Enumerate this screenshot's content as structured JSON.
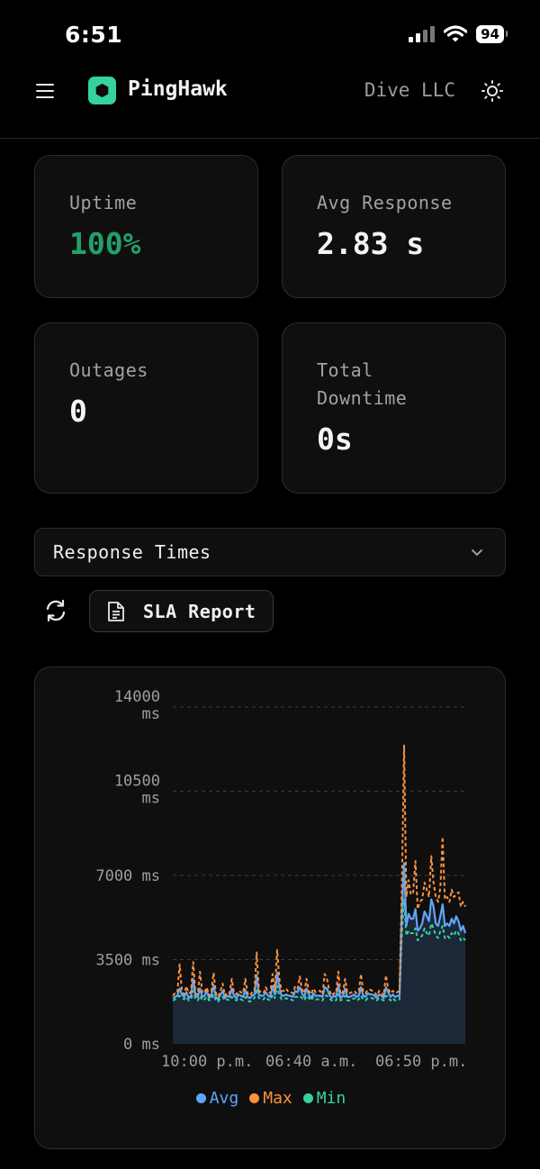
{
  "status": {
    "time": "6:51",
    "battery": "94"
  },
  "header": {
    "brand": "PingHawk",
    "org": "Dive LLC",
    "icons": [
      "menu-icon",
      "hexagon-logo-icon",
      "sun-icon"
    ]
  },
  "stats": [
    {
      "label": "Uptime",
      "value": "100%",
      "color": "#22a06b"
    },
    {
      "label": "Avg Response",
      "value": "2.83 s",
      "color": "#f4f4f5"
    },
    {
      "label": "Outages",
      "value": "0",
      "color": "#f4f4f5"
    },
    {
      "label": "Total\nDowntime",
      "value": "0s",
      "color": "#f4f4f5"
    }
  ],
  "controls": {
    "selected_view": "Response Times",
    "sla_button": "SLA Report"
  },
  "chart_data": {
    "type": "line",
    "title": "",
    "x_ticks": [
      "10:00 p.m.",
      "06:40 a.m.",
      "06:50 p.m."
    ],
    "y_ticks": [
      "0 ms",
      "3500 ms",
      "7000 ms",
      "10500 ms",
      "14000 ms"
    ],
    "ylim": [
      0,
      14000
    ],
    "grid": true,
    "legend_position": "bottom",
    "series": [
      {
        "name": "Avg",
        "color": "#60a5fa",
        "values": [
          1900,
          1950,
          2000,
          2300,
          2050,
          1950,
          2150,
          1900,
          2000,
          2700,
          2000,
          1950,
          2300,
          1950,
          2000,
          2200,
          1900,
          2000,
          2450,
          1950,
          1850,
          2050,
          2200,
          1900,
          2000,
          1950,
          2300,
          2000,
          1900,
          2050,
          2000,
          1950,
          2250,
          1950,
          1900,
          2000,
          2050,
          2850,
          2050,
          2000,
          2000,
          2150,
          2000,
          1950,
          2400,
          2050,
          2950,
          2350,
          2000,
          2000,
          2050,
          2000,
          2000,
          1950,
          2200,
          2150,
          2350,
          2100,
          1950,
          2300,
          2050,
          1900,
          2100,
          2000,
          2000,
          2000,
          1950,
          2350,
          2300,
          2050,
          1900,
          2000,
          1950,
          2450,
          1900,
          2000,
          2300,
          1950,
          1950,
          2000,
          2050,
          1950,
          2000,
          2350,
          2000,
          1950,
          2100,
          2050,
          2050,
          2000,
          1900,
          2050,
          2000,
          1900,
          2350,
          2150,
          1950,
          2050,
          1950,
          2000,
          2000,
          5500,
          7500,
          4900,
          5400,
          5200,
          5200,
          5600,
          4700,
          4800,
          5000,
          5500,
          5300,
          5100,
          6000,
          5700,
          5000,
          4900,
          5300,
          5800,
          4900,
          5000,
          4900,
          5200,
          5000,
          5300,
          5100,
          4700,
          4900,
          4600
        ]
      },
      {
        "name": "Max",
        "color": "#fb923c",
        "values": [
          2000,
          2100,
          2100,
          3300,
          2200,
          2050,
          2400,
          2100,
          2150,
          3400,
          2100,
          2050,
          3000,
          2100,
          2150,
          2350,
          2000,
          2150,
          2950,
          2100,
          1950,
          2200,
          2500,
          2000,
          2150,
          2100,
          2700,
          2100,
          2050,
          2200,
          2150,
          2100,
          2700,
          2100,
          2000,
          2150,
          2200,
          3800,
          2200,
          2150,
          2100,
          2350,
          2150,
          2100,
          2900,
          2200,
          3900,
          2700,
          2200,
          2200,
          2300,
          2150,
          2150,
          2100,
          2400,
          2300,
          2800,
          2250,
          2100,
          2700,
          2200,
          2050,
          2300,
          2150,
          2200,
          2200,
          2050,
          2900,
          2700,
          2250,
          2000,
          2100,
          2100,
          3000,
          2050,
          2150,
          2700,
          2100,
          2100,
          2150,
          2200,
          2100,
          2150,
          2900,
          2150,
          2100,
          2250,
          2250,
          2200,
          2150,
          2000,
          2200,
          2150,
          2000,
          2850,
          2300,
          2100,
          2200,
          2100,
          2150,
          2200,
          6500,
          12400,
          6100,
          6800,
          6200,
          6300,
          7600,
          5600,
          5900,
          6000,
          6700,
          6400,
          6100,
          7800,
          6700,
          6100,
          5900,
          6500,
          8600,
          6000,
          6100,
          5900,
          6400,
          6100,
          6200,
          6300,
          5700,
          5900,
          5700
        ]
      },
      {
        "name": "Min",
        "color": "#34d399",
        "values": [
          1800,
          1850,
          1900,
          2000,
          1900,
          1850,
          1950,
          1800,
          1850,
          2200,
          1850,
          1800,
          2000,
          1800,
          1850,
          1950,
          1800,
          1850,
          2050,
          1800,
          1750,
          1900,
          1950,
          1800,
          1850,
          1800,
          1950,
          1850,
          1800,
          1900,
          1850,
          1800,
          1950,
          1800,
          1750,
          1850,
          1900,
          2300,
          1900,
          1850,
          1850,
          1950,
          1850,
          1800,
          2050,
          1900,
          2400,
          2000,
          1850,
          1850,
          1900,
          1850,
          1850,
          1800,
          1950,
          1950,
          2000,
          1900,
          1800,
          2000,
          1900,
          1800,
          1950,
          1850,
          1850,
          1850,
          1800,
          2000,
          2000,
          1900,
          1800,
          1850,
          1800,
          2050,
          1800,
          1850,
          2000,
          1800,
          1800,
          1850,
          1900,
          1800,
          1850,
          2000,
          1850,
          1800,
          1900,
          1900,
          1900,
          1850,
          1800,
          1900,
          1850,
          1800,
          2000,
          1950,
          1800,
          1900,
          1800,
          1850,
          1850,
          4500,
          6000,
          4500,
          4700,
          4600,
          4600,
          4800,
          4300,
          4400,
          4500,
          4800,
          4600,
          4500,
          5000,
          4800,
          4500,
          4400,
          4700,
          4900,
          4400,
          4500,
          4400,
          4600,
          4500,
          4700,
          4600,
          4300,
          4400,
          4300
        ]
      }
    ],
    "area_series": "Avg"
  }
}
